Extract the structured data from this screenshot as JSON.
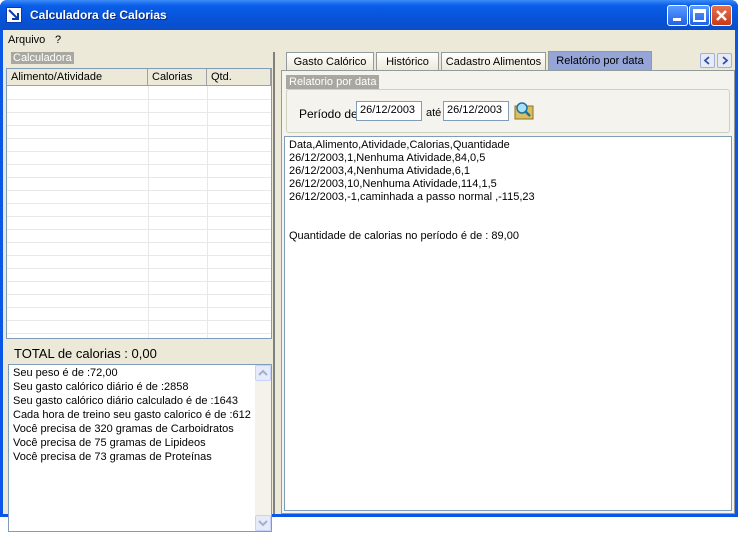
{
  "window": {
    "title": "Calculadora de Calorias"
  },
  "menu": {
    "arquivo": "Arquivo",
    "help": "?"
  },
  "left": {
    "group_label": "Calculadora",
    "columns": [
      "Alimento/Atividade",
      "Calorias",
      "Qtd."
    ],
    "total": "TOTAL de calorias : 0,00",
    "info_lines": [
      "Seu peso é de :72,00",
      "Seu gasto calórico diário é de :2858",
      "Seu gasto calórico diário calculado é de :1643",
      "Cada hora de treino seu gasto calorico é de :612",
      "Você precisa de 320 gramas de Carboidratos",
      "Você precisa de  75 gramas de Lipideos",
      "Você precisa de  73 gramas de Proteínas"
    ]
  },
  "tabs": [
    "Gasto Calórico",
    "Histórico",
    "Cadastro Alimentos",
    "Relatório por data"
  ],
  "report": {
    "group_label": "Relatorio por data",
    "period_label": "Período de",
    "date_from": "26/12/2003",
    "until_label": "até",
    "date_to": "26/12/2003",
    "lines": [
      "Data,Alimento,Atividade,Calorias,Quantidade",
      "26/12/2003,1,Nenhuma Atividade,84,0,5",
      "26/12/2003,4,Nenhuma Atividade,6,1",
      "26/12/2003,10,Nenhuma Atividade,114,1,5",
      "26/12/2003,-1,caminhada a passo normal ,-115,23",
      "",
      "",
      "Quantidade de calorias no período é de : 89,00"
    ]
  },
  "icons": {
    "search": "search-icon",
    "app": "app-icon",
    "minimize": "minimize-icon",
    "maximize": "maximize-icon",
    "close": "close-icon"
  },
  "colors": {
    "titlebar": "#0753d9",
    "active_tab": "#95a5d8",
    "client": "#ece9d8"
  }
}
